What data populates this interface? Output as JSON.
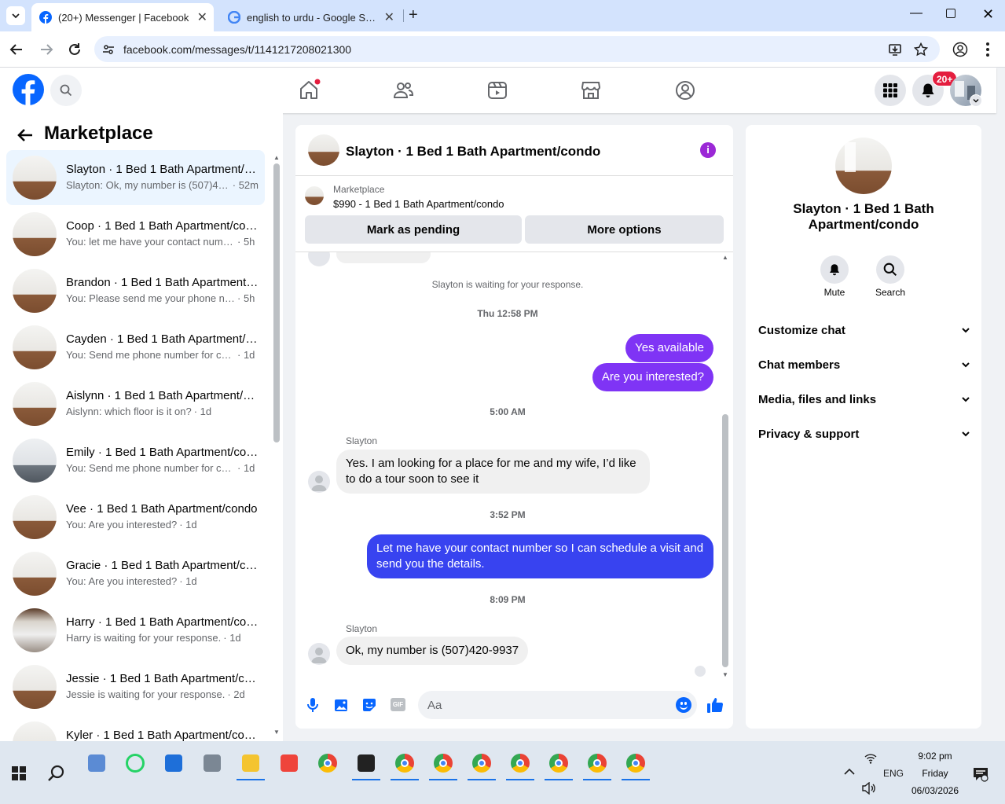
{
  "browser": {
    "tabs": [
      {
        "title": "(20+) Messenger | Facebook",
        "active": true
      },
      {
        "title": "english to urdu - Google Search",
        "active": false
      }
    ],
    "url": "facebook.com/messages/t/1141217208021300"
  },
  "fb_header": {
    "notification_badge": "20+"
  },
  "left": {
    "title": "Marketplace",
    "conversations": [
      {
        "name": "Slayton · 1 Bed 1 Bath Apartment/condo",
        "preview": "Slayton: Ok, my number is (507)420-9937",
        "time": "· 52m",
        "selected": true
      },
      {
        "name": "Coop · 1 Bed 1 Bath Apartment/condo",
        "preview": "You: let me have your contact number",
        "time": "· 5h"
      },
      {
        "name": "Brandon · 1 Bed 1 Bath Apartment/condo",
        "preview": "You: Please send me your phone number",
        "time": "· 5h"
      },
      {
        "name": "Cayden · 1 Bed 1 Bath Apartment/condo",
        "preview": "You: Send me phone number for contact",
        "time": "· 1d"
      },
      {
        "name": "Aislynn · 1 Bed 1 Bath Apartment/condo",
        "preview": "Aislynn: which floor is it on?",
        "time": "· 1d"
      },
      {
        "name": "Emily · 1 Bed 1 Bath Apartment/condo",
        "preview": "You: Send me phone number for contact",
        "time": "· 1d"
      },
      {
        "name": "Vee · 1 Bed 1 Bath Apartment/condo",
        "preview": "You: Are you interested?",
        "time": "· 1d"
      },
      {
        "name": "Gracie · 1 Bed 1 Bath Apartment/condo",
        "preview": "You: Are you interested?",
        "time": "· 1d"
      },
      {
        "name": "Harry · 1 Bed 1 Bath Apartment/condo",
        "preview": "Harry is waiting for your response.",
        "time": "· 1d"
      },
      {
        "name": "Jessie · 1 Bed 1 Bath Apartment/condo",
        "preview": "Jessie is waiting for your response.",
        "time": "· 2d"
      },
      {
        "name": "Kyler · 1 Bed 1 Bath Apartment/condo",
        "preview": "",
        "time": ""
      }
    ]
  },
  "chat": {
    "title": "Slayton · 1 Bed 1 Bath Apartment/condo",
    "listing_source": "Marketplace",
    "listing": "$990 - 1 Bed 1 Bath Apartment/condo",
    "mark_pending": "Mark as pending",
    "more_options": "More options",
    "waiting": "Slayton is waiting for your response.",
    "ts1": "Thu 12:58 PM",
    "out1": "Yes available",
    "out2": "Are you interested?",
    "ts2": "5:00 AM",
    "sender": "Slayton",
    "in1": "Yes. I am looking for a place for me and my wife, I’d like to do a tour soon to see it",
    "ts3": "3:52 PM",
    "out3": "Let me have your contact number so I can schedule a visit and send you the details.",
    "ts4": "8:09 PM",
    "in2": "Ok, my number is (507)420-9937",
    "composer_placeholder": "Aa",
    "colors": {
      "accent_purple": "#7f34f5",
      "accent_blue": "#3843f0",
      "fb_blue": "#0866ff"
    }
  },
  "right": {
    "title": "Slayton · 1 Bed 1 Bath Apartment/condo",
    "mute": "Mute",
    "search": "Search",
    "options": [
      "Customize chat",
      "Chat members",
      "Media, files and links",
      "Privacy & support"
    ]
  },
  "taskbar": {
    "lang": "ENG",
    "time": "9:02 pm",
    "day": "Friday",
    "date": "06/03/2026"
  }
}
